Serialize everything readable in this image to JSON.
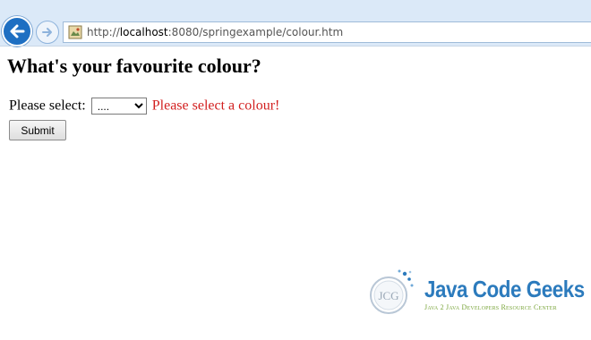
{
  "browser": {
    "url_prefix": "http://",
    "url_host": "localhost",
    "url_rest": ":8080/springexample/colour.htm"
  },
  "page": {
    "title": "What's your favourite colour?",
    "select_label": "Please select:",
    "select_value": "....",
    "error": "Please select a colour!",
    "submit_label": "Submit"
  },
  "logo": {
    "text": "Java Code Geeks",
    "tagline": "Java 2 Java Developers Resource Center",
    "mark": "JCG"
  },
  "colors": {
    "error": "#d21f1f",
    "brand_blue": "#2c7bbd",
    "brand_green": "#7aa53b"
  }
}
